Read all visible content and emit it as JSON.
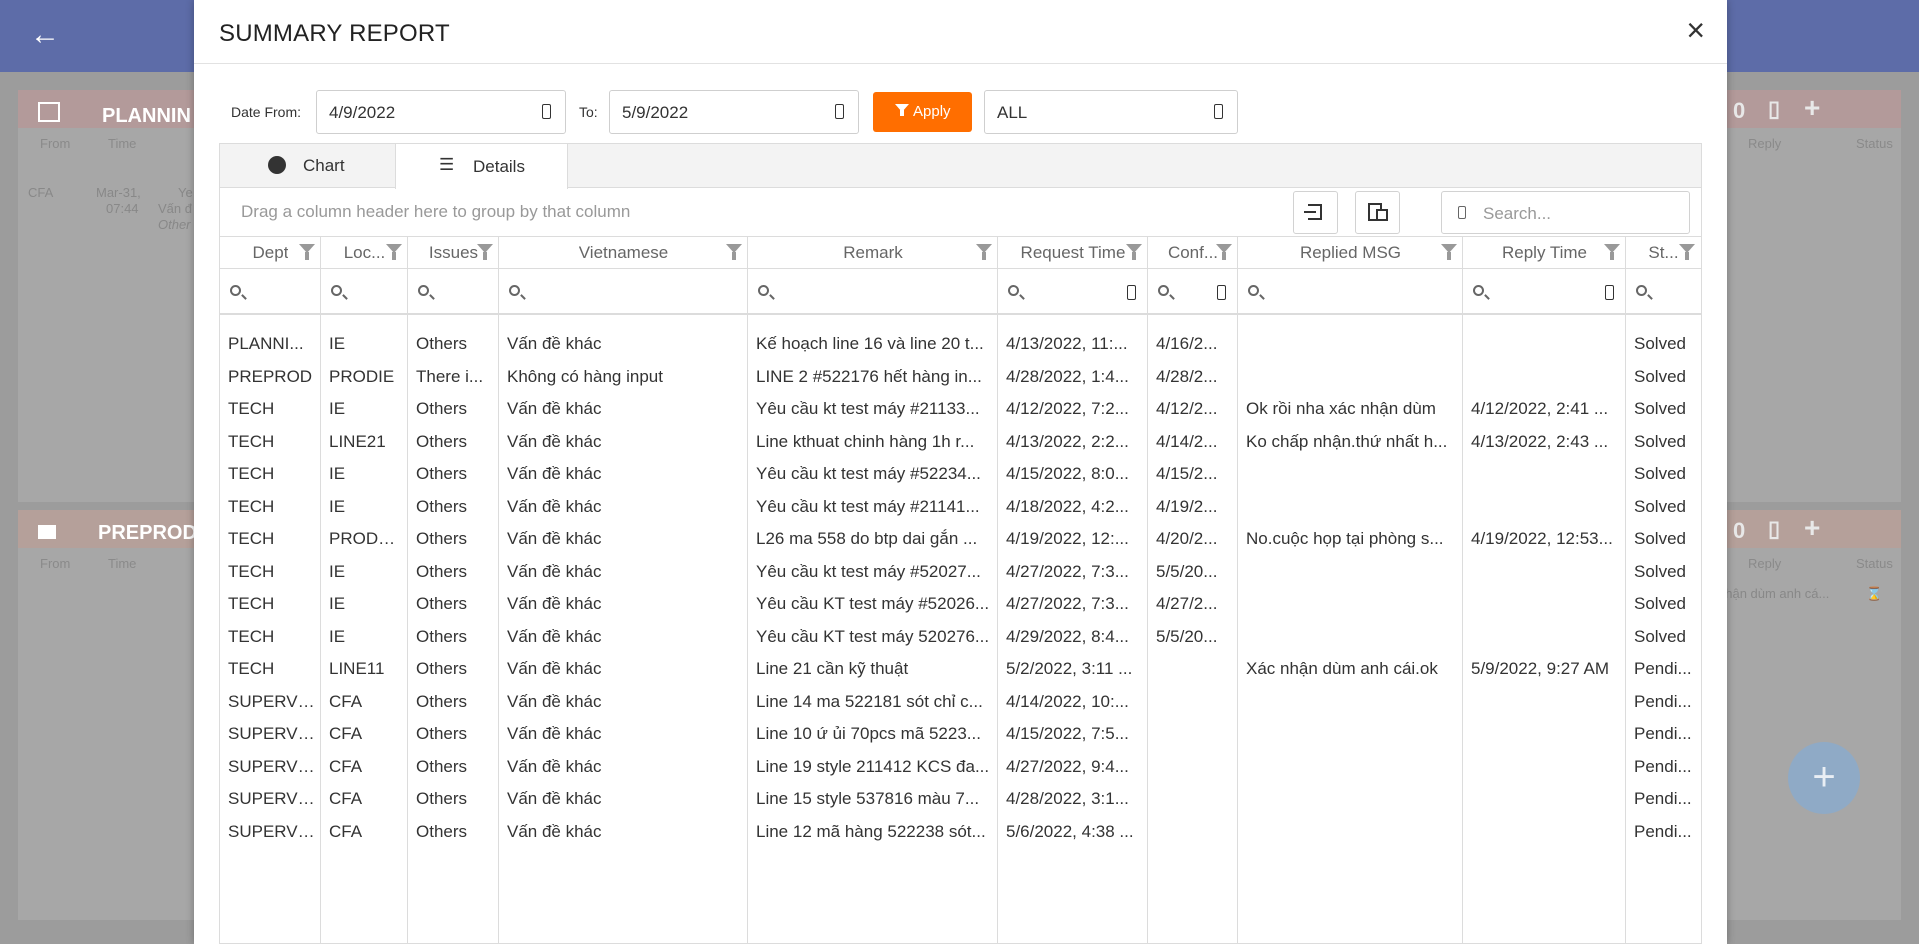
{
  "background": {
    "cards": [
      {
        "title": "PLANNIN",
        "cols": [
          "From",
          "Time",
          "Reply",
          "Status"
        ],
        "row": {
          "from": "CFA",
          "date": "Mar-31,",
          "time": "07:44",
          "text1": "Ye",
          "text2": "Vấn đ",
          "text3": "Other"
        },
        "count": "0"
      },
      {
        "title": "PREPROD",
        "cols": [
          "From",
          "Time",
          "Reply",
          "Status"
        ],
        "reply_text": "nhận dùm anh cá...",
        "count": "0"
      }
    ]
  },
  "modal": {
    "title": "SUMMARY REPORT",
    "close_icon": "×"
  },
  "filters": {
    "date_from_label": "Date From:",
    "date_from": "4/9/2022",
    "to_label": "To:",
    "date_to": "5/9/2022",
    "apply_label": "Apply",
    "dept_select": "ALL"
  },
  "tabs": [
    {
      "label": "Chart",
      "icon": "pie-chart-icon",
      "active": false
    },
    {
      "label": "Details",
      "icon": "list-icon",
      "active": true
    }
  ],
  "grid": {
    "group_panel_text": "Drag a column header here to group by that column",
    "search_placeholder": "Search...",
    "columns": [
      "Dept",
      "Loc...",
      "Issues",
      "Vietnamese",
      "Remark",
      "Request Time",
      "Conf...",
      "Replied MSG",
      "Reply Time",
      "St..."
    ],
    "rows": [
      [
        "PLANNI...",
        "IE",
        "Others",
        "Vấn đề khác",
        "Kế hoạch line 16 và line 20 t...",
        "4/13/2022, 11:...",
        "4/16/2...",
        "",
        "",
        "Solved"
      ],
      [
        "PREPROD",
        "PRODIE",
        "There i...",
        "Không có hàng input",
        "LINE 2 #522176 hết hàng in...",
        "4/28/2022, 1:4...",
        "4/28/2...",
        "",
        "",
        "Solved"
      ],
      [
        "TECH",
        "IE",
        "Others",
        "Vấn đề khác",
        "Yêu cầu kt test máy #21133...",
        "4/12/2022, 7:2...",
        "4/12/2...",
        "Ok rồi nha xác nhận dùm",
        "4/12/2022, 2:41 ...",
        "Solved"
      ],
      [
        "TECH",
        "LINE21",
        "Others",
        "Vấn đề khác",
        "Line kthuat chinh hàng 1h r...",
        "4/13/2022, 2:2...",
        "4/14/2...",
        "Ko chấp nhận.thứ nhất h...",
        "4/13/2022, 2:43 ...",
        "Solved"
      ],
      [
        "TECH",
        "IE",
        "Others",
        "Vấn đề khác",
        "Yêu cầu kt test máy #52234...",
        "4/15/2022, 8:0...",
        "4/15/2...",
        "",
        "",
        "Solved"
      ],
      [
        "TECH",
        "IE",
        "Others",
        "Vấn đề khác",
        "Yêu cầu kt test máy #21141...",
        "4/18/2022, 4:2...",
        "4/19/2...",
        "",
        "",
        "Solved"
      ],
      [
        "TECH",
        "PRODS...",
        "Others",
        "Vấn đề khác",
        "L26 ma 558 do btp dai gắn ...",
        "4/19/2022, 12:...",
        "4/20/2...",
        "No.cuộc họp tại phòng s...",
        "4/19/2022, 12:53...",
        "Solved"
      ],
      [
        "TECH",
        "IE",
        "Others",
        "Vấn đề khác",
        "Yêu cầu kt test máy #52027...",
        "4/27/2022, 7:3...",
        "5/5/20...",
        "",
        "",
        "Solved"
      ],
      [
        "TECH",
        "IE",
        "Others",
        "Vấn đề khác",
        "Yêu cầu KT test máy #52026...",
        "4/27/2022, 7:3...",
        "4/27/2...",
        "",
        "",
        "Solved"
      ],
      [
        "TECH",
        "IE",
        "Others",
        "Vấn đề khác",
        "Yêu cầu KT test máy 520276...",
        "4/29/2022, 8:4...",
        "5/5/20...",
        "",
        "",
        "Solved"
      ],
      [
        "TECH",
        "LINE11",
        "Others",
        "Vấn đề khác",
        "Line 21 cần kỹ thuật",
        "5/2/2022, 3:11 ...",
        "",
        "Xác nhận dùm anh cái.ok",
        "5/9/2022, 9:27 AM",
        "Pendi..."
      ],
      [
        "SUPERVI...",
        "CFA",
        "Others",
        "Vấn đề khác",
        "Line 14 ma 522181 sót chỉ c...",
        "4/14/2022, 10:...",
        "",
        "",
        "",
        "Pendi..."
      ],
      [
        "SUPERVI...",
        "CFA",
        "Others",
        "Vấn đề khác",
        "Line 10 ứ ủi 70pcs mã 5223...",
        "4/15/2022, 7:5...",
        "",
        "",
        "",
        "Pendi..."
      ],
      [
        "SUPERVI...",
        "CFA",
        "Others",
        "Vấn đề khác",
        "Line 19 style 211412 KCS đa...",
        "4/27/2022, 9:4...",
        "",
        "",
        "",
        "Pendi..."
      ],
      [
        "SUPERVI...",
        "CFA",
        "Others",
        "Vấn đề khác",
        "Line 15 style 537816 màu 7...",
        "4/28/2022, 3:1...",
        "",
        "",
        "",
        "Pendi..."
      ],
      [
        "SUPERVI...",
        "CFA",
        "Others",
        "Vấn đề khác",
        "Line 12 mã hàng 522238 sót...",
        "5/6/2022, 4:38 ...",
        "",
        "",
        "",
        "Pendi..."
      ]
    ]
  }
}
